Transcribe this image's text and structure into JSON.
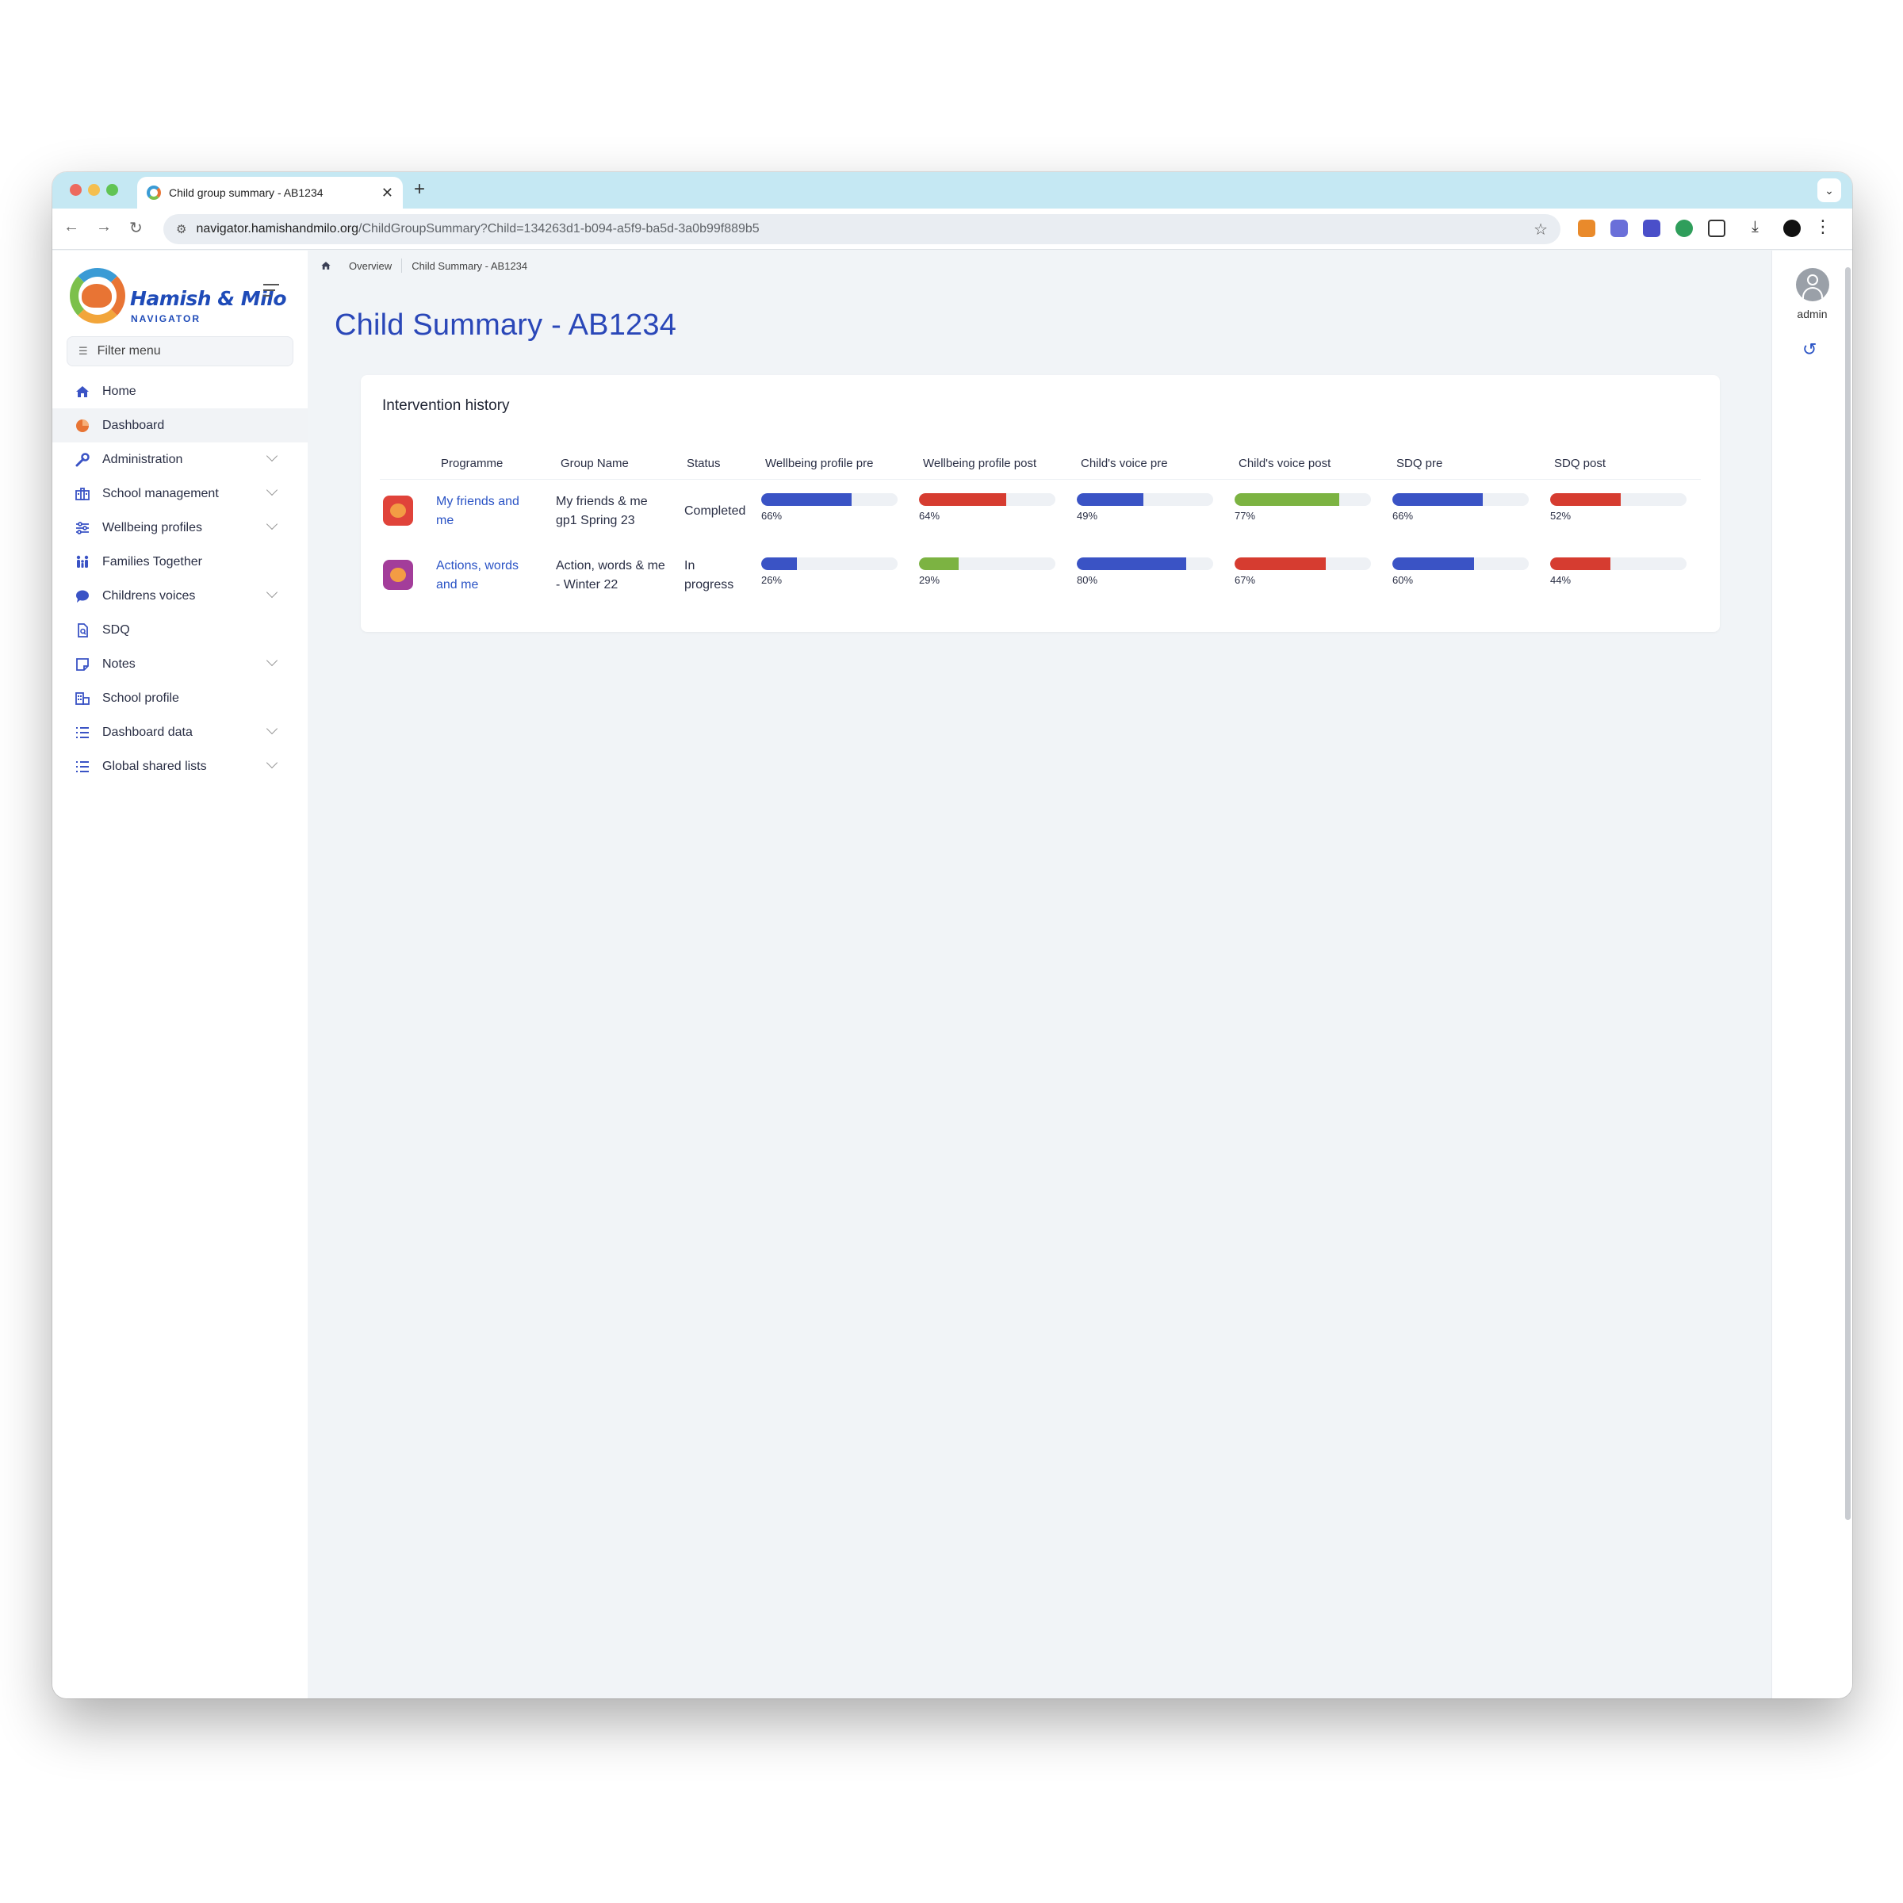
{
  "browser": {
    "tab_title": "Child group summary - AB1234",
    "new_tab": "+",
    "url_host": "navigator.hamishandmilo.org",
    "url_path": "/ChildGroupSummary?Child=134263d1-b094-a5f9-ba5d-3a0b99f889b5"
  },
  "brand": {
    "name": "Hamish & Milo",
    "subtitle": "NAVIGATOR"
  },
  "sidebar": {
    "filter_label": "Filter menu",
    "items": [
      {
        "label": "Home",
        "icon": "home-icon"
      },
      {
        "label": "Dashboard",
        "icon": "pie-chart-icon",
        "active": true
      },
      {
        "label": "Administration",
        "icon": "wrench-icon",
        "expandable": true
      },
      {
        "label": "School management",
        "icon": "school-icon",
        "expandable": true
      },
      {
        "label": "Wellbeing profiles",
        "icon": "sliders-icon",
        "expandable": true
      },
      {
        "label": "Families Together",
        "icon": "family-icon"
      },
      {
        "label": "Childrens voices",
        "icon": "speech-bubble-icon",
        "expandable": true
      },
      {
        "label": "SDQ",
        "icon": "document-icon"
      },
      {
        "label": "Notes",
        "icon": "note-icon",
        "expandable": true
      },
      {
        "label": "School profile",
        "icon": "building-icon"
      },
      {
        "label": "Dashboard data",
        "icon": "list-icon",
        "expandable": true
      },
      {
        "label": "Global shared lists",
        "icon": "list-icon",
        "expandable": true
      }
    ]
  },
  "breadcrumb": {
    "items": [
      "Overview",
      "Child Summary - AB1234"
    ]
  },
  "page": {
    "title": "Child Summary - AB1234"
  },
  "intervention": {
    "title": "Intervention history",
    "columns": [
      "Programme",
      "Group Name",
      "Status",
      "Wellbeing profile pre",
      "Wellbeing profile post",
      "Child's voice pre",
      "Child's voice post",
      "SDQ pre",
      "SDQ post"
    ],
    "rows": [
      {
        "programme_line1": "My friends and",
        "programme_line2": "me",
        "group_line1": "My friends & me",
        "group_line2": "gp1 Spring 23",
        "status_line1": "Completed",
        "status_line2": "",
        "bars": [
          {
            "value": 66,
            "label": "66%",
            "color": "#3a53c5"
          },
          {
            "value": 64,
            "label": "64%",
            "color": "#d63c30"
          },
          {
            "value": 49,
            "label": "49%",
            "color": "#3a53c5"
          },
          {
            "value": 77,
            "label": "77%",
            "color": "#7cb342"
          },
          {
            "value": 66,
            "label": "66%",
            "color": "#3a53c5"
          },
          {
            "value": 52,
            "label": "52%",
            "color": "#d63c30"
          }
        ]
      },
      {
        "programme_line1": "Actions, words",
        "programme_line2": "and me",
        "group_line1": "Action, words & me",
        "group_line2": "- Winter 22",
        "status_line1": "In",
        "status_line2": "progress",
        "bars": [
          {
            "value": 26,
            "label": "26%",
            "color": "#3a53c5"
          },
          {
            "value": 29,
            "label": "29%",
            "color": "#7cb342"
          },
          {
            "value": 80,
            "label": "80%",
            "color": "#3a53c5"
          },
          {
            "value": 67,
            "label": "67%",
            "color": "#d63c30"
          },
          {
            "value": 60,
            "label": "60%",
            "color": "#3a53c5"
          },
          {
            "value": 44,
            "label": "44%",
            "color": "#d63c30"
          }
        ]
      }
    ]
  },
  "user": {
    "name": "admin"
  }
}
